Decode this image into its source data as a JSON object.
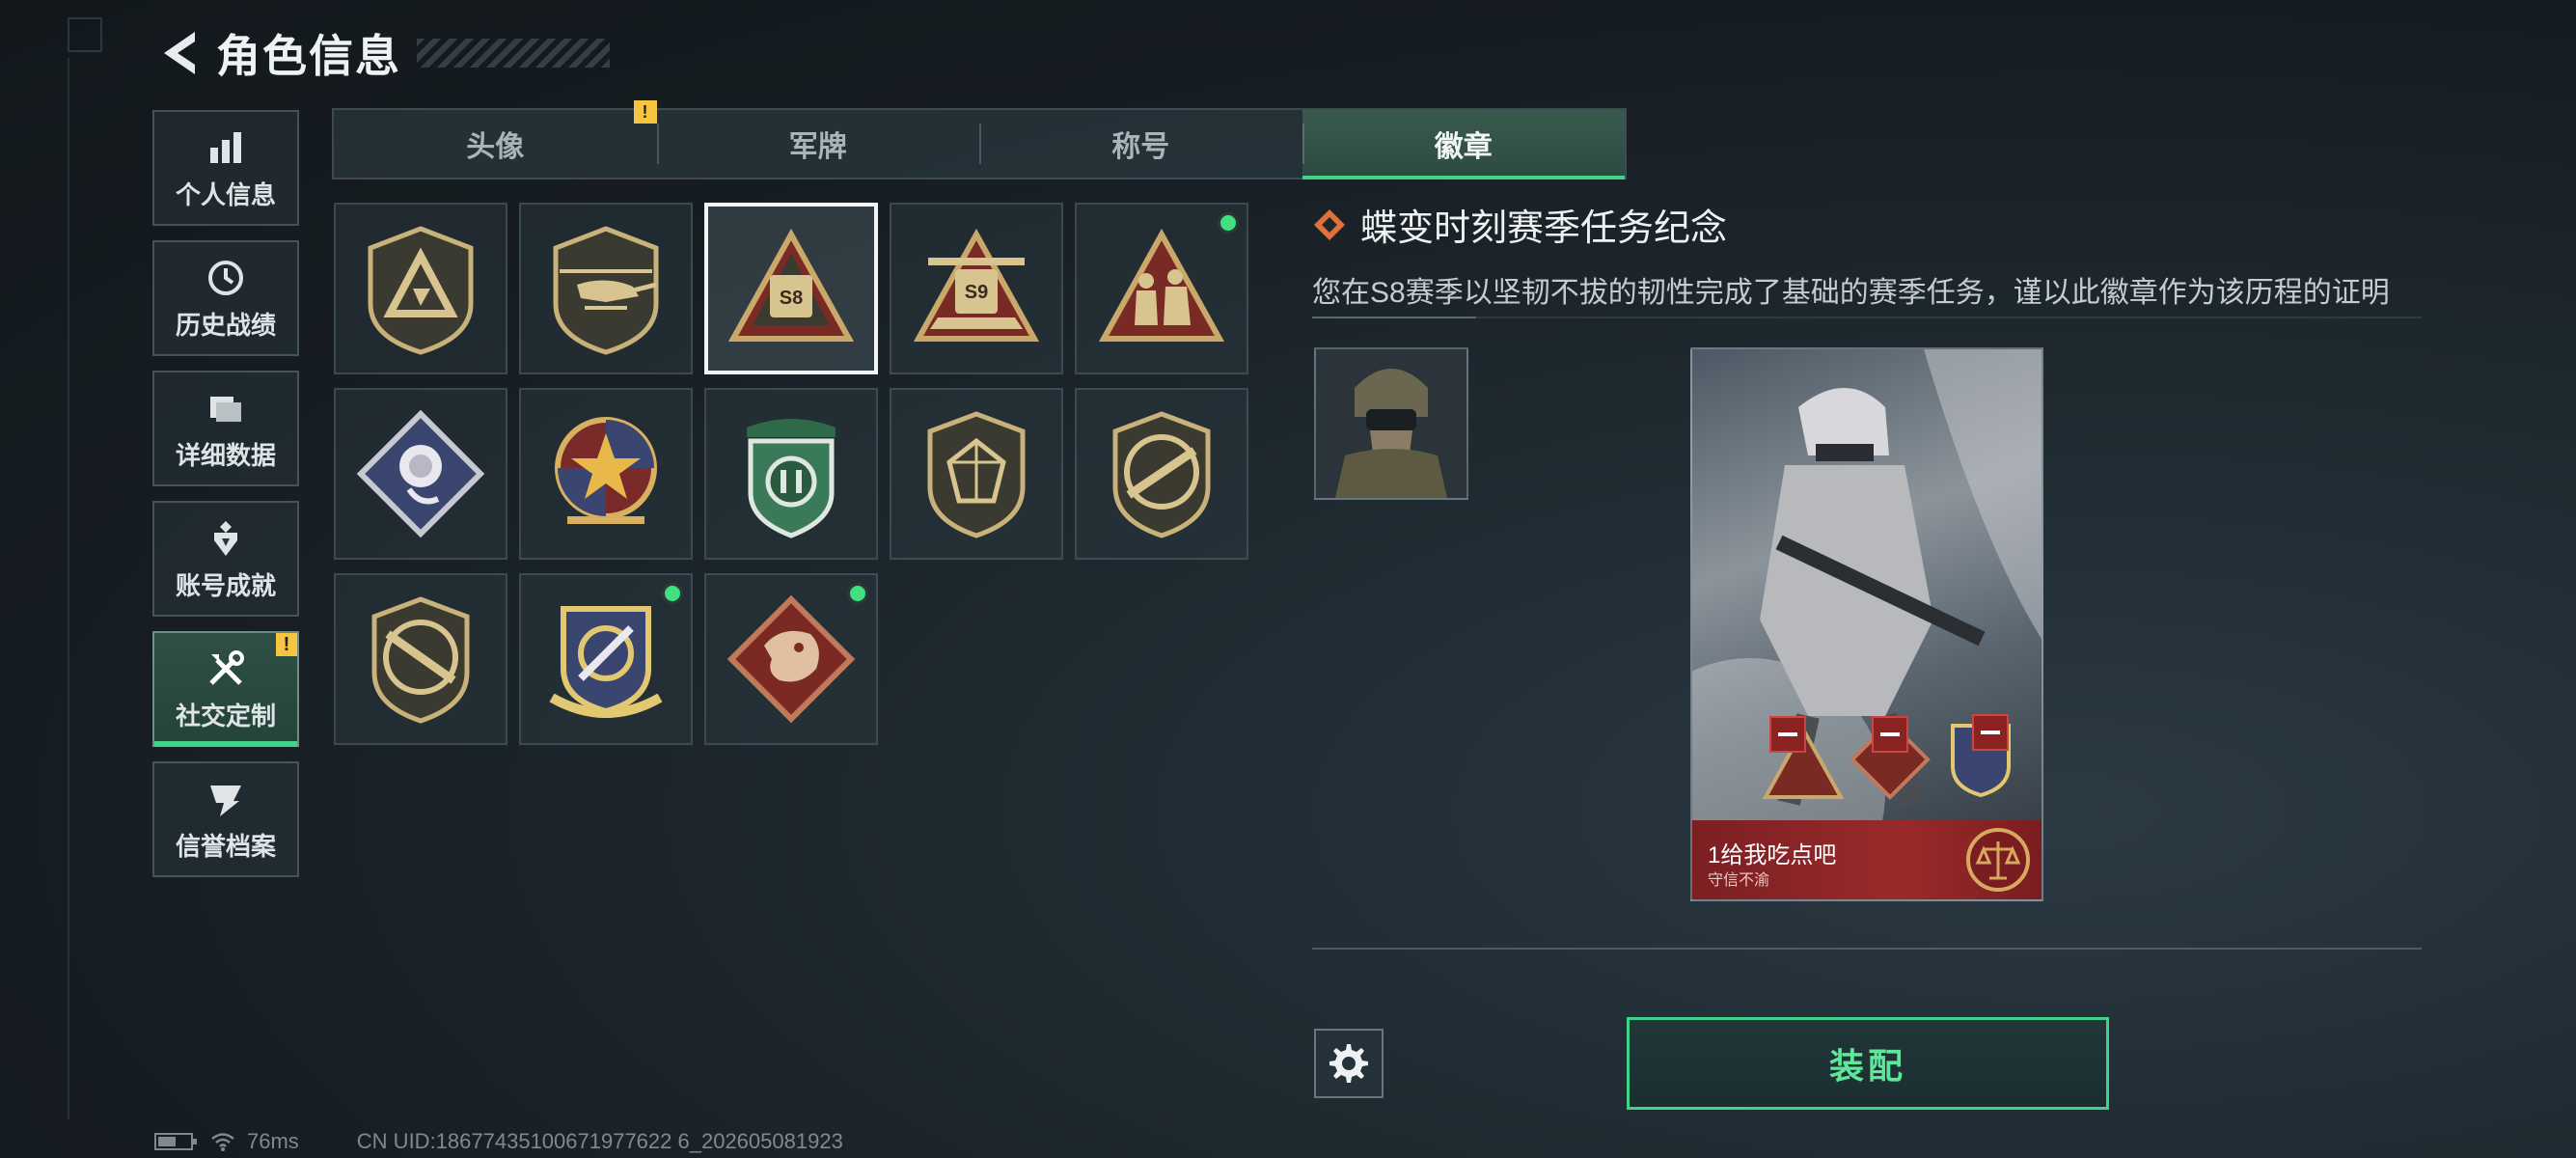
{
  "header": {
    "title": "角色信息"
  },
  "sidebar": {
    "items": [
      {
        "label": "个人信息",
        "icon": "bar-chart-icon"
      },
      {
        "label": "历史战绩",
        "icon": "history-clock-icon"
      },
      {
        "label": "详细数据",
        "icon": "folder-icon"
      },
      {
        "label": "账号成就",
        "icon": "achievement-icon",
        "badge": ""
      },
      {
        "label": "社交定制",
        "icon": "tools-icon",
        "badge": "!"
      },
      {
        "label": "信誉档案",
        "icon": "reputation-icon"
      }
    ],
    "active_index": 4
  },
  "tabs": [
    {
      "label": "头像",
      "badge": "!"
    },
    {
      "label": "军牌"
    },
    {
      "label": "称号"
    },
    {
      "label": "徽章"
    }
  ],
  "active_tab": 3,
  "badges": [
    {
      "name": "badge-triangle-shield",
      "new": false,
      "selected": false
    },
    {
      "name": "badge-helicopter-shield",
      "new": false,
      "selected": false
    },
    {
      "name": "badge-s8-triangle",
      "new": false,
      "selected": true
    },
    {
      "name": "badge-s9-triangle",
      "new": false,
      "selected": false
    },
    {
      "name": "badge-soldiers-triangle",
      "new": true,
      "selected": false
    },
    {
      "name": "badge-rose-diamond",
      "new": false,
      "selected": false
    },
    {
      "name": "badge-star-wreath",
      "new": false,
      "selected": false
    },
    {
      "name": "badge-green-shield",
      "new": false,
      "selected": false
    },
    {
      "name": "badge-gem-shield",
      "new": false,
      "selected": false
    },
    {
      "name": "badge-rifle-shield",
      "new": false,
      "selected": false
    },
    {
      "name": "badge-rifle-shield-2",
      "new": false,
      "selected": false
    },
    {
      "name": "badge-crosshair-shield",
      "new": true,
      "selected": false
    },
    {
      "name": "badge-dragon-diamond",
      "new": true,
      "selected": false
    }
  ],
  "detail": {
    "title": "蝶变时刻赛季任务纪念",
    "description": "您在S8赛季以坚韧不拔的韧性完成了基础的赛季任务，谨以此徽章作为该历程的证明"
  },
  "card": {
    "player_name": "1给我吃点吧",
    "subtitle": "守信不渝"
  },
  "actions": {
    "equip_label": "装配",
    "settings_icon": "gear-icon"
  },
  "status": {
    "ping": "76ms",
    "uid": "CN UID:18677435100671977622 6_202605081923"
  },
  "colors": {
    "accent_green": "#3fd48a",
    "warning_yellow": "#f5c542",
    "card_red": "#9a2a2a"
  }
}
